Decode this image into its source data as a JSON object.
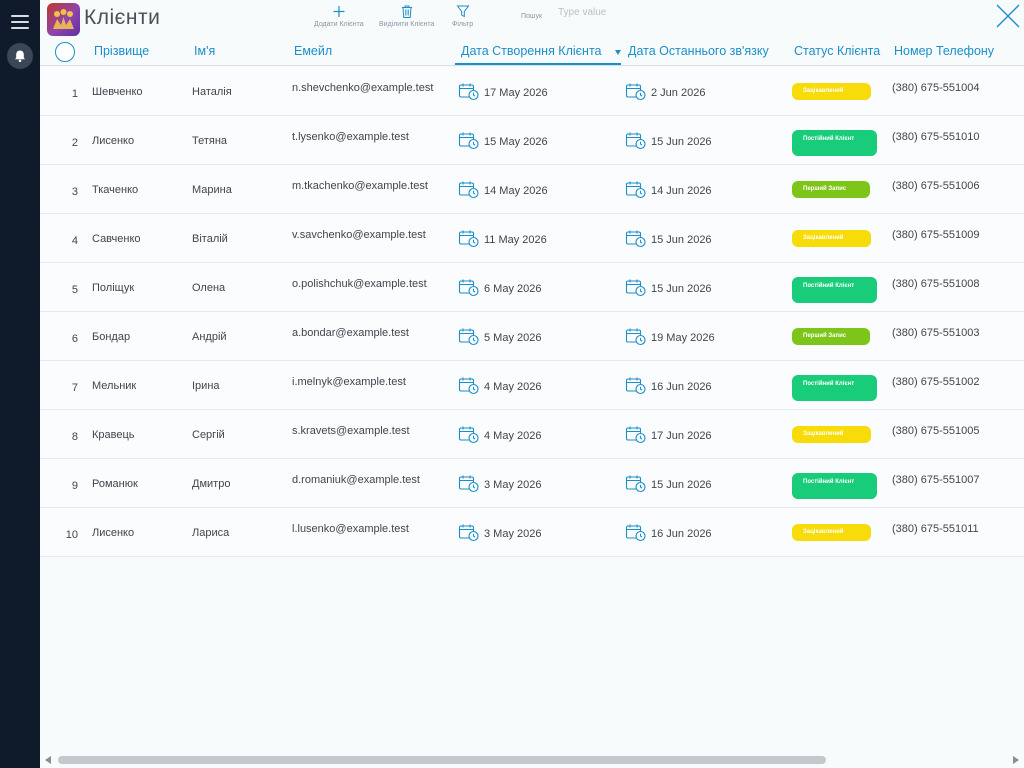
{
  "app": {
    "title": "Клієнти",
    "accent": "#1b8fc9",
    "sidebar_color": "#0f1b2b",
    "icons": [
      "hamburger-menu-icon",
      "bell-icon",
      "app-logo",
      "plus-icon",
      "trash-icon",
      "filter-icon",
      "close-icon",
      "calendar-icon"
    ]
  },
  "toolbar": {
    "add_label": "Додати Клієнта",
    "delete_label": "Виділити Клієнта",
    "filter_label": "Фільтр",
    "search_label": "Пошук",
    "search_placeholder": "Type value"
  },
  "table": {
    "columns": [
      "Прізвище",
      "Ім'я",
      "Емейл",
      "Дата Створення Клієнта",
      "Дата Останнього зв'язку",
      "Статус Клієнта",
      "Номер Телефону"
    ],
    "sorted_column": "Дата Створення Клієнта",
    "sort_direction": "descending",
    "status_colors": {
      "Зацікавлений": "#f7dc0a",
      "Постійний Клієнт": "#19cc7a",
      "Перший Запис": "#7ec51a"
    },
    "rows": [
      {
        "idx": "1",
        "surname": "Шевченко",
        "name": "Наталія",
        "email": "n.shevchenko@example.test",
        "created": "17 May 2026",
        "last_contact": "2 Jun 2026",
        "status": "Зацікавлений",
        "phone": "(380) 675-551004"
      },
      {
        "idx": "2",
        "surname": "Лисенко",
        "name": "Тетяна",
        "email": "t.lysenko@example.test",
        "created": "15 May 2026",
        "last_contact": "15 Jun 2026",
        "status": "Постійний Клієнт",
        "phone": "(380) 675-551010"
      },
      {
        "idx": "3",
        "surname": "Ткаченко",
        "name": "Марина",
        "email": "m.tkachenko@example.test",
        "created": "14 May 2026",
        "last_contact": "14 Jun 2026",
        "status": "Перший Запис",
        "phone": "(380) 675-551006"
      },
      {
        "idx": "4",
        "surname": "Савченко",
        "name": "Віталій",
        "email": "v.savchenko@example.test",
        "created": "11 May 2026",
        "last_contact": "15 Jun 2026",
        "status": "Зацікавлений",
        "phone": "(380) 675-551009"
      },
      {
        "idx": "5",
        "surname": "Поліщук",
        "name": "Олена",
        "email": "o.polishchuk@example.test",
        "created": "6 May 2026",
        "last_contact": "15 Jun 2026",
        "status": "Постійний Клієнт",
        "phone": "(380) 675-551008"
      },
      {
        "idx": "6",
        "surname": "Бондар",
        "name": "Андрій",
        "email": "a.bondar@example.test",
        "created": "5 May 2026",
        "last_contact": "19 May 2026",
        "status": "Перший Запис",
        "phone": "(380) 675-551003"
      },
      {
        "idx": "7",
        "surname": "Мельник",
        "name": "Ірина",
        "email": "i.melnyk@example.test",
        "created": "4 May 2026",
        "last_contact": "16 Jun 2026",
        "status": "Постійний Клієнт",
        "phone": "(380) 675-551002"
      },
      {
        "idx": "8",
        "surname": "Кравець",
        "name": "Сергій",
        "email": "s.kravets@example.test",
        "created": "4 May 2026",
        "last_contact": "17 Jun 2026",
        "status": "Зацікавлений",
        "phone": "(380) 675-551005"
      },
      {
        "idx": "9",
        "surname": "Романюк",
        "name": "Дмитро",
        "email": "d.romaniuk@example.test",
        "created": "3 May 2026",
        "last_contact": "15 Jun 2026",
        "status": "Постійний Клієнт",
        "phone": "(380) 675-551007"
      },
      {
        "idx": "10",
        "surname": "Лисенко",
        "name": "Лариса",
        "email": "l.lusenko@example.test",
        "created": "3 May 2026",
        "last_contact": "16 Jun 2026",
        "status": "Зацікавлений",
        "phone": "(380) 675-551011"
      }
    ]
  }
}
